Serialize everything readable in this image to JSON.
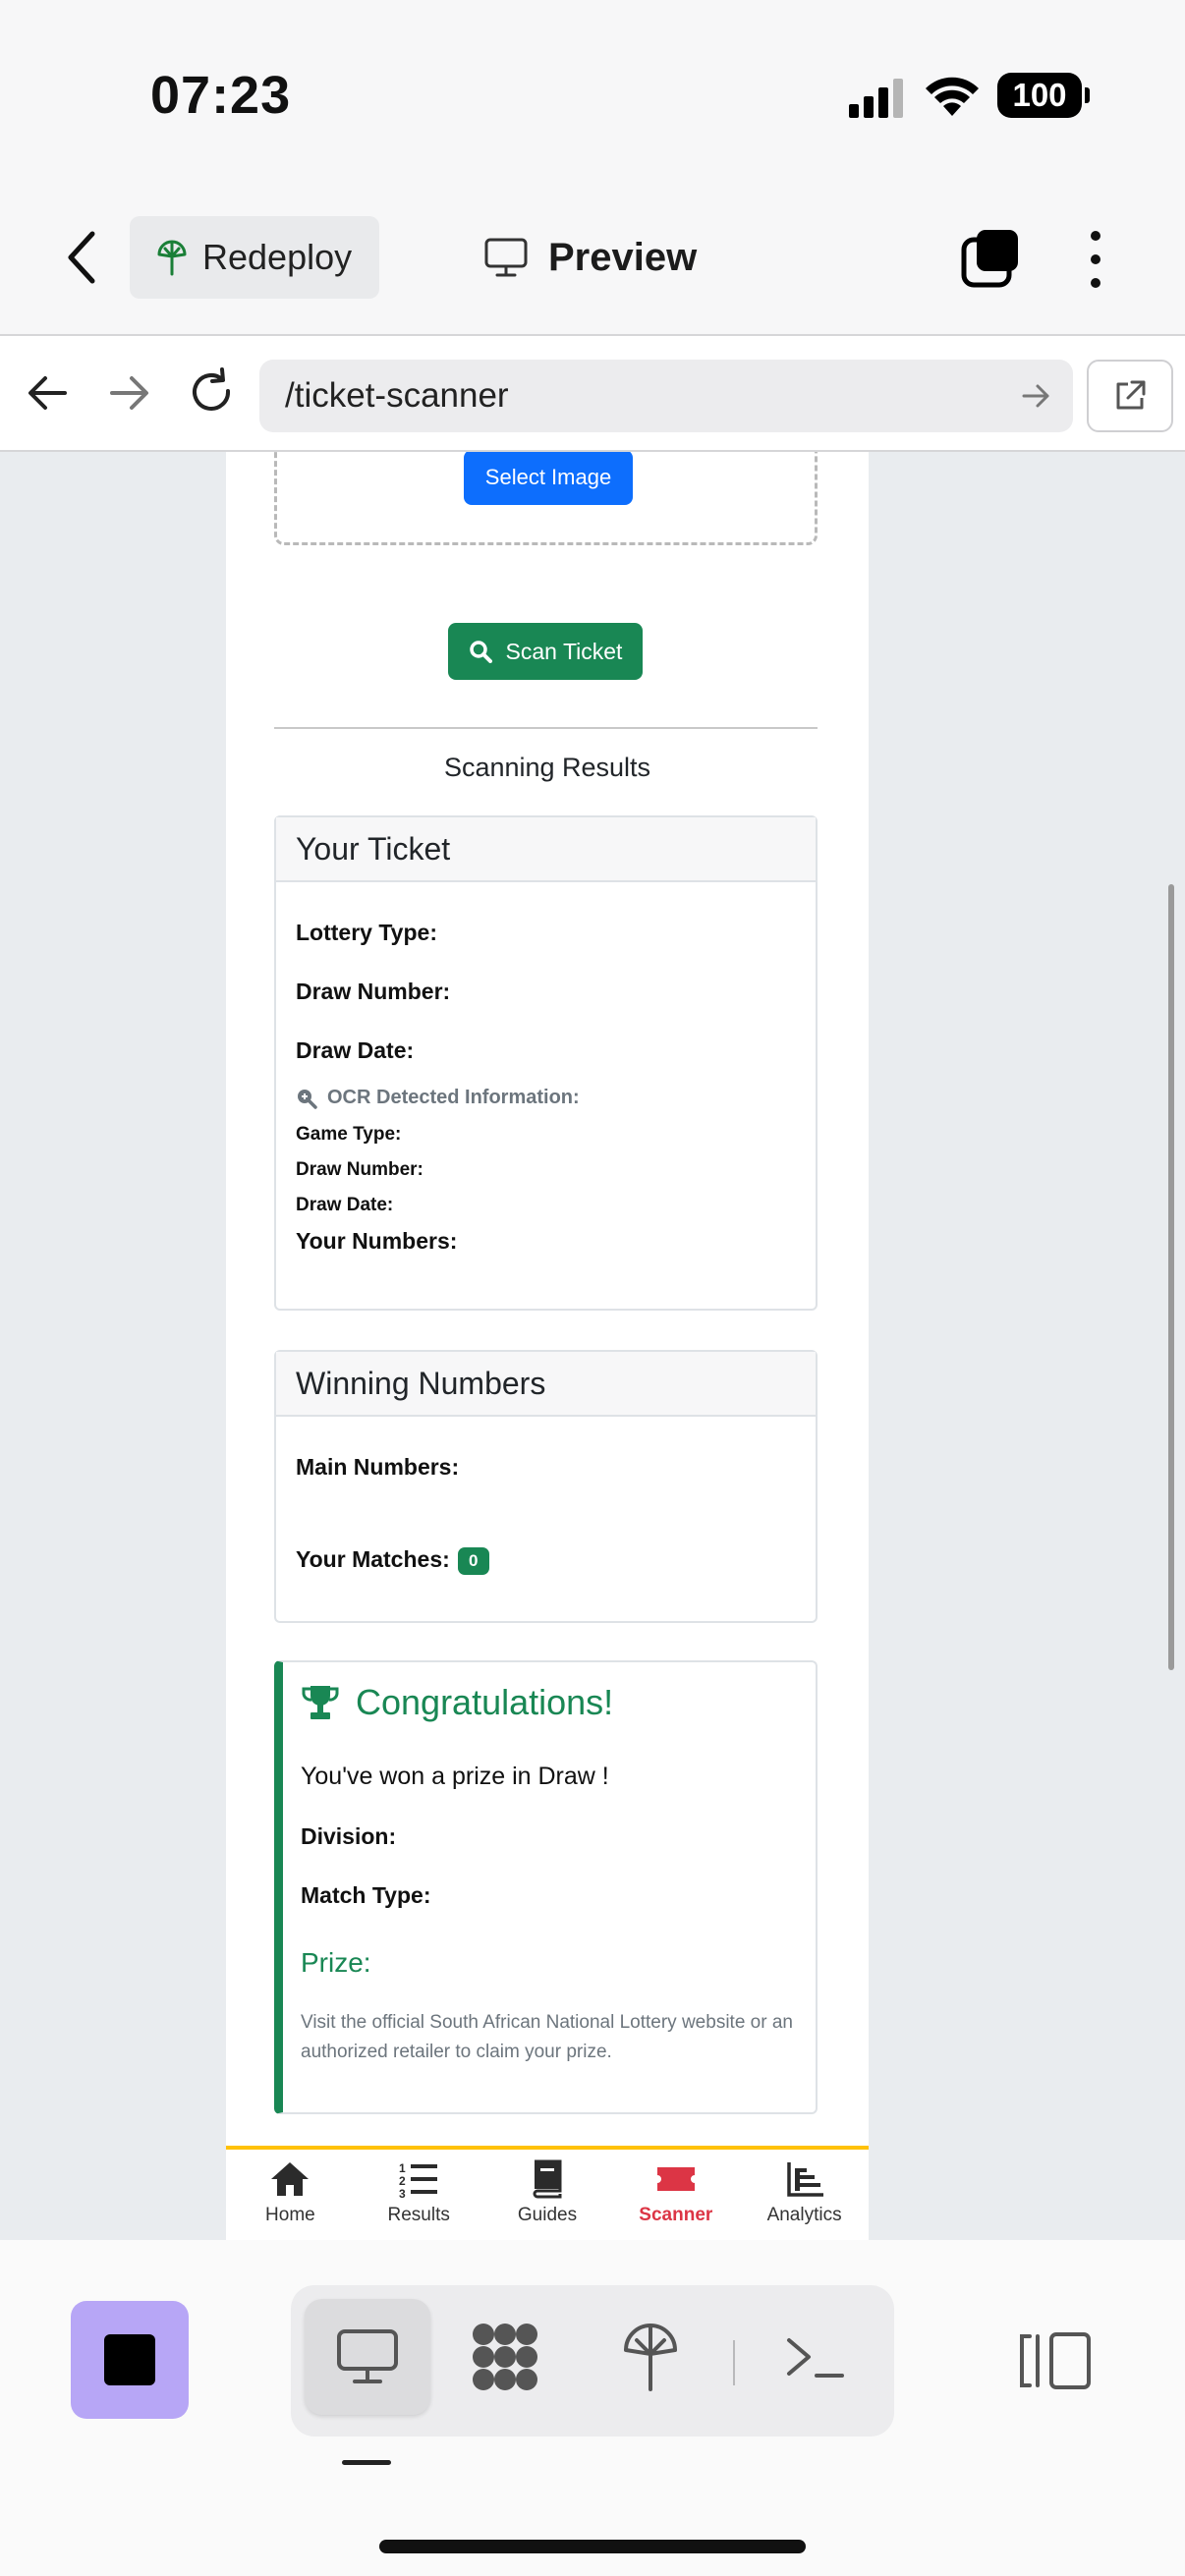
{
  "status_bar": {
    "time": "07:23",
    "battery": "100"
  },
  "app_header": {
    "redeploy_label": "Redeploy",
    "preview_label": "Preview"
  },
  "browser": {
    "url": "/ticket-scanner"
  },
  "scanner": {
    "select_image_label": "Select Image",
    "scan_button_label": "Scan Ticket",
    "results_title": "Scanning Results"
  },
  "your_ticket": {
    "title": "Your Ticket",
    "lottery_type_label": "Lottery Type:",
    "draw_number_label": "Draw Number:",
    "draw_date_label": "Draw Date:",
    "ocr_title": "OCR Detected Information:",
    "ocr_game_type_label": "Game Type:",
    "ocr_draw_number_label": "Draw Number:",
    "ocr_draw_date_label": "Draw Date:",
    "your_numbers_label": "Your Numbers:"
  },
  "winning_numbers": {
    "title": "Winning Numbers",
    "main_numbers_label": "Main Numbers:",
    "your_matches_label": "Your Matches:",
    "matches_count": "0"
  },
  "prize": {
    "title": "Congratulations!",
    "message": "You've won a prize in Draw !",
    "division_label": "Division:",
    "match_type_label": "Match Type:",
    "prize_label": "Prize:",
    "note": "Visit the official South African National Lottery website or an authorized retailer to claim your prize."
  },
  "tabbar": {
    "items": [
      {
        "label": "Home",
        "icon": "home-icon"
      },
      {
        "label": "Results",
        "icon": "list-ordered-icon"
      },
      {
        "label": "Guides",
        "icon": "book-icon"
      },
      {
        "label": "Scanner",
        "icon": "ticket-icon",
        "active": true
      },
      {
        "label": "Analytics",
        "icon": "bar-chart-icon"
      }
    ]
  },
  "colors": {
    "primary": "#0d6efd",
    "success": "#198754",
    "danger": "#dc3545",
    "warning": "#ffc107",
    "dock_accent": "#b7a6f6"
  }
}
